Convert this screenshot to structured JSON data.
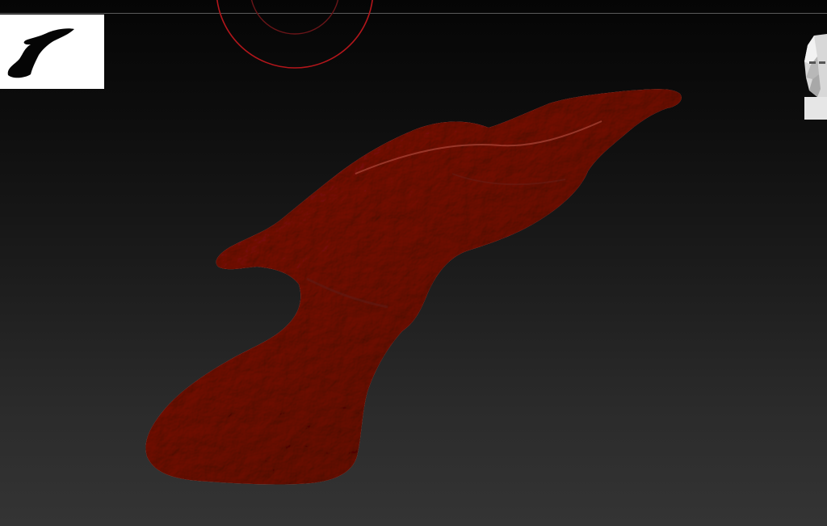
{
  "app": {
    "accent_color": "#c0392b",
    "mesh_color": "#9a3a30"
  },
  "viewport": {
    "navigator_thumbnail": "mesh-silhouette-thumbnail",
    "transform_gizmo": "red-circle-gizmo",
    "orientation_widget": "head-orientation-icon",
    "model": "sculpted-clay-mesh"
  }
}
